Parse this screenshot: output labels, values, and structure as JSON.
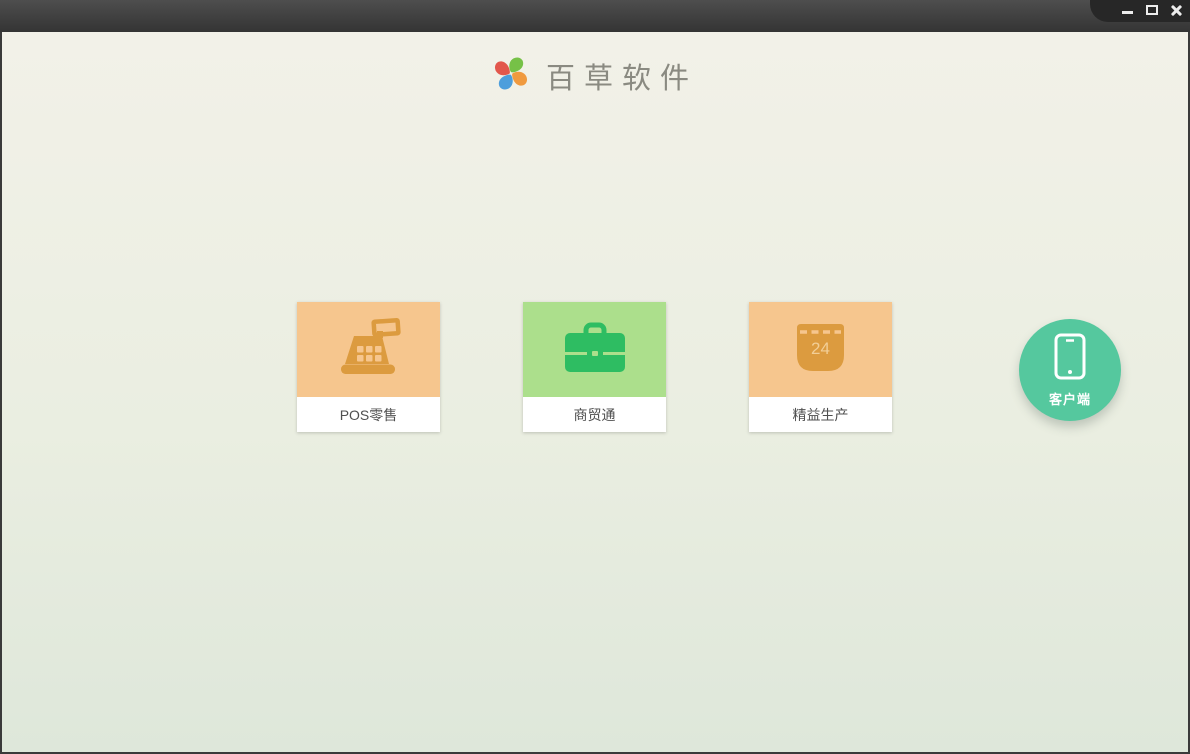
{
  "titlebar": {
    "controls": [
      {
        "name": "minimize"
      },
      {
        "name": "maximize"
      },
      {
        "name": "close"
      }
    ]
  },
  "header": {
    "app_title": "百草软件",
    "logo": "pinwheel-logo",
    "logo_petal_colors": {
      "top": "#76C147",
      "right": "#F09A3F",
      "bottom": "#4D9EDC",
      "left": "#E2574C"
    }
  },
  "products": [
    {
      "label": "POS零售",
      "icon": "cash-register-icon",
      "bg": "#F6C68E",
      "icon_color": "#DC9B3F"
    },
    {
      "label": "商贸通",
      "icon": "briefcase-icon",
      "bg": "#ACDF8C",
      "icon_color": "#2EBD62"
    },
    {
      "label": "精益生产",
      "icon": "calendar-icon",
      "bg": "#F6C68E",
      "icon_color": "#DC9B3F",
      "calendar_day": "24"
    }
  ],
  "client_button": {
    "label": "客户端",
    "icon": "smartphone-icon",
    "bg": "#55C89E"
  },
  "colors": {
    "titlebar_top": "#4E4E4E",
    "titlebar_bottom": "#343434",
    "controls_tab": "#272727",
    "window_border": "#3A3A3A",
    "bg_gradient_top": "#F2F1E8",
    "bg_gradient_bottom": "#DEE7DA",
    "card_label_text": "#4F4F4F",
    "app_title_text": "#8A8A81"
  }
}
